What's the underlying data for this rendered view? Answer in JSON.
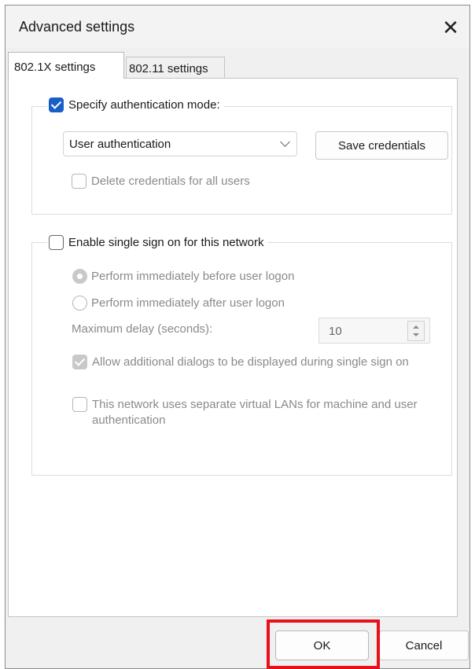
{
  "window": {
    "title": "Advanced settings",
    "close_glyph": "✕"
  },
  "tabs": [
    {
      "label": "802.1X settings",
      "active": true
    },
    {
      "label": "802.11 settings",
      "active": false
    }
  ],
  "auth_group": {
    "checkbox_label": "Specify authentication mode:",
    "checked": true,
    "mode_value": "User authentication",
    "save_credentials_label": "Save credentials",
    "delete_credentials_label": "Delete credentials for all users"
  },
  "sso_group": {
    "checkbox_label": "Enable single sign on for this network",
    "checked": false,
    "radio_before_label": "Perform immediately before user logon",
    "radio_after_label": "Perform immediately after user logon",
    "max_delay_label": "Maximum delay (seconds):",
    "max_delay_value": "10",
    "allow_dialogs_label": "Allow additional dialogs to be displayed during single sign on",
    "separate_vlans_label": "This network uses separate virtual LANs for machine and user authentication"
  },
  "footer": {
    "ok_label": "OK",
    "cancel_label": "Cancel"
  },
  "colors": {
    "accent": "#1a5fc7",
    "highlight": "#e8101a"
  }
}
